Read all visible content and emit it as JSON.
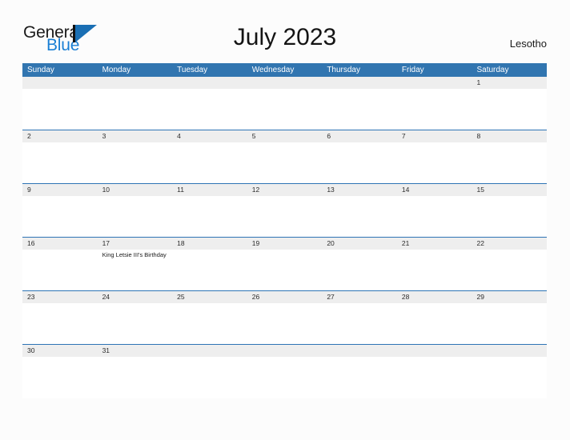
{
  "brand": {
    "word_one": "General",
    "word_two": "Blue",
    "mark_icon": "sail-triangle-icon",
    "accent_color": "#1a7fd4"
  },
  "header": {
    "title": "July 2023",
    "country": "Lesotho"
  },
  "colors": {
    "header_blue": "#3175b0",
    "row_divider": "#2e74b5",
    "daynum_band": "#eeeeee",
    "page_background": "#fcfcfc"
  },
  "calendar": {
    "weekdays": [
      "Sunday",
      "Monday",
      "Tuesday",
      "Wednesday",
      "Thursday",
      "Friday",
      "Saturday"
    ],
    "weeks": [
      {
        "days": [
          {
            "num": "",
            "events": []
          },
          {
            "num": "",
            "events": []
          },
          {
            "num": "",
            "events": []
          },
          {
            "num": "",
            "events": []
          },
          {
            "num": "",
            "events": []
          },
          {
            "num": "",
            "events": []
          },
          {
            "num": "1",
            "events": []
          }
        ]
      },
      {
        "days": [
          {
            "num": "2",
            "events": []
          },
          {
            "num": "3",
            "events": []
          },
          {
            "num": "4",
            "events": []
          },
          {
            "num": "5",
            "events": []
          },
          {
            "num": "6",
            "events": []
          },
          {
            "num": "7",
            "events": []
          },
          {
            "num": "8",
            "events": []
          }
        ]
      },
      {
        "days": [
          {
            "num": "9",
            "events": []
          },
          {
            "num": "10",
            "events": []
          },
          {
            "num": "11",
            "events": []
          },
          {
            "num": "12",
            "events": []
          },
          {
            "num": "13",
            "events": []
          },
          {
            "num": "14",
            "events": []
          },
          {
            "num": "15",
            "events": []
          }
        ]
      },
      {
        "days": [
          {
            "num": "16",
            "events": []
          },
          {
            "num": "17",
            "events": [
              "King Letsie III's Birthday"
            ]
          },
          {
            "num": "18",
            "events": []
          },
          {
            "num": "19",
            "events": []
          },
          {
            "num": "20",
            "events": []
          },
          {
            "num": "21",
            "events": []
          },
          {
            "num": "22",
            "events": []
          }
        ]
      },
      {
        "days": [
          {
            "num": "23",
            "events": []
          },
          {
            "num": "24",
            "events": []
          },
          {
            "num": "25",
            "events": []
          },
          {
            "num": "26",
            "events": []
          },
          {
            "num": "27",
            "events": []
          },
          {
            "num": "28",
            "events": []
          },
          {
            "num": "29",
            "events": []
          }
        ]
      },
      {
        "days": [
          {
            "num": "30",
            "events": []
          },
          {
            "num": "31",
            "events": []
          },
          {
            "num": "",
            "events": []
          },
          {
            "num": "",
            "events": []
          },
          {
            "num": "",
            "events": []
          },
          {
            "num": "",
            "events": []
          },
          {
            "num": "",
            "events": []
          }
        ]
      }
    ]
  }
}
